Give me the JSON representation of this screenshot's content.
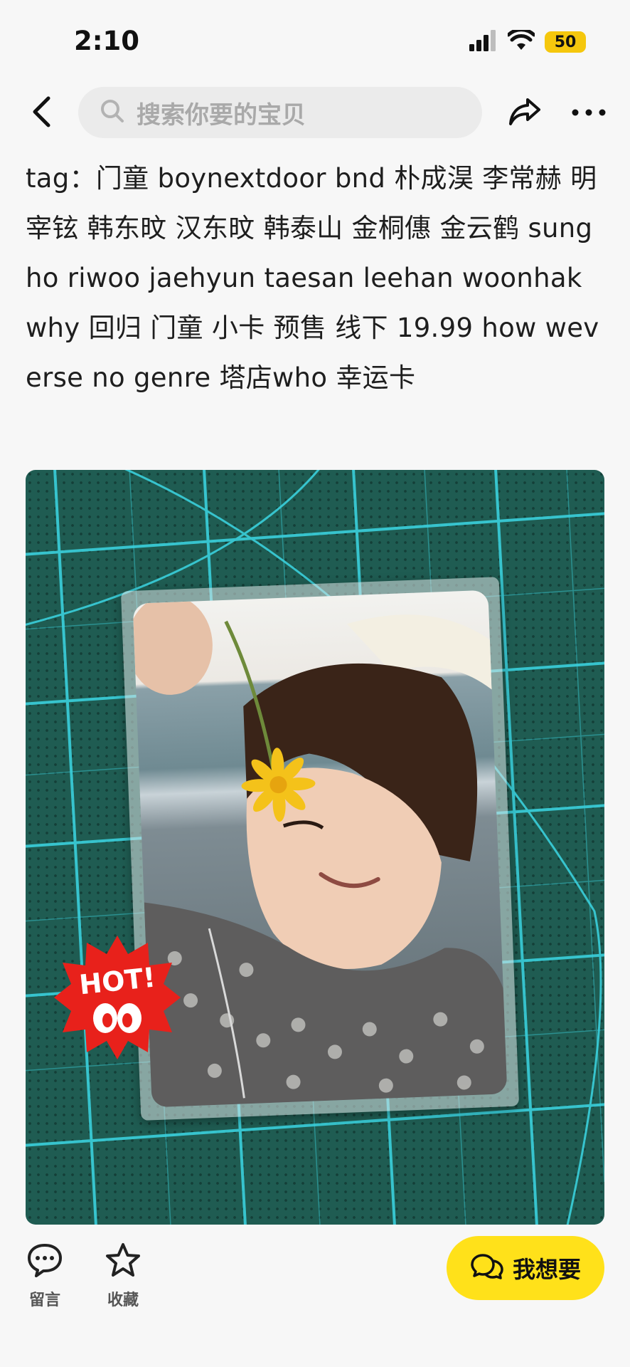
{
  "status_bar": {
    "time": "2:10",
    "battery": "50",
    "battery_color": "#f5c70d"
  },
  "nav": {
    "search_placeholder": "搜索你要的宝贝"
  },
  "description": "tag：门童 boynextdoor bnd 朴成淏 李常赫 明宰铉 韩东旼 汉东旼 韩泰山 金桐僡 金云鹤 sungho riwoo jaehyun taesan leehan woonhak why 回归  门童 小卡 预售 线下 19.99 how weverse  no genre 塔店who 幸运卡",
  "image": {
    "badge_text": "HOT!",
    "mat_color": "#1f5c52",
    "grid_color": "#3ad0dc"
  },
  "bottom_bar": {
    "comment_label": "留言",
    "favorite_label": "收藏",
    "want_label": "我想要",
    "want_color": "#ffe11a"
  }
}
